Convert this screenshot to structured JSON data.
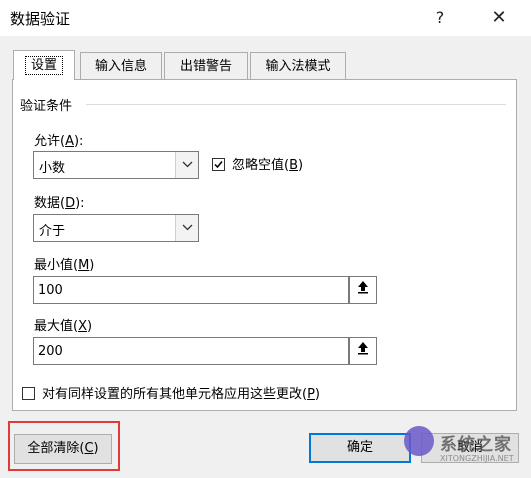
{
  "window": {
    "title": "数据验证",
    "help": "?",
    "close": "✕"
  },
  "tabs": [
    {
      "label": "设置",
      "active": true
    },
    {
      "label": "输入信息",
      "active": false
    },
    {
      "label": "出错警告",
      "active": false
    },
    {
      "label": "输入法模式",
      "active": false
    }
  ],
  "validation": {
    "group_label": "验证条件",
    "allow_label": "允许(",
    "allow_key": "A",
    "allow_suffix": "):",
    "allow_value": "小数",
    "ignore_blank_label": "忽略空值(",
    "ignore_blank_key": "B",
    "ignore_blank_suffix": ")",
    "ignore_blank_checked": true,
    "data_label": "数据(",
    "data_key": "D",
    "data_suffix": "):",
    "data_value": "介于",
    "min_label": "最小值(",
    "min_key": "M",
    "min_suffix": ")",
    "min_value": "100",
    "max_label": "最大值(",
    "max_key": "X",
    "max_suffix": ")",
    "max_value": "200",
    "apply_all_label": "对有同样设置的所有其他单元格应用这些更改(",
    "apply_all_key": "P",
    "apply_all_suffix": ")",
    "apply_all_checked": false
  },
  "buttons": {
    "clear_all": "全部清除(",
    "clear_all_key": "C",
    "clear_all_suffix": ")",
    "ok": "确定",
    "cancel": "取消"
  },
  "icons": {
    "dropdown": "chevron-down-icon",
    "range_ref": "range-select-icon",
    "check": "check-icon"
  },
  "colors": {
    "highlight": "#e03a3a",
    "primary_border": "#0078d7"
  },
  "watermark": {
    "text": "系统之家",
    "sub": "XITONGZHIJIA.NET"
  }
}
